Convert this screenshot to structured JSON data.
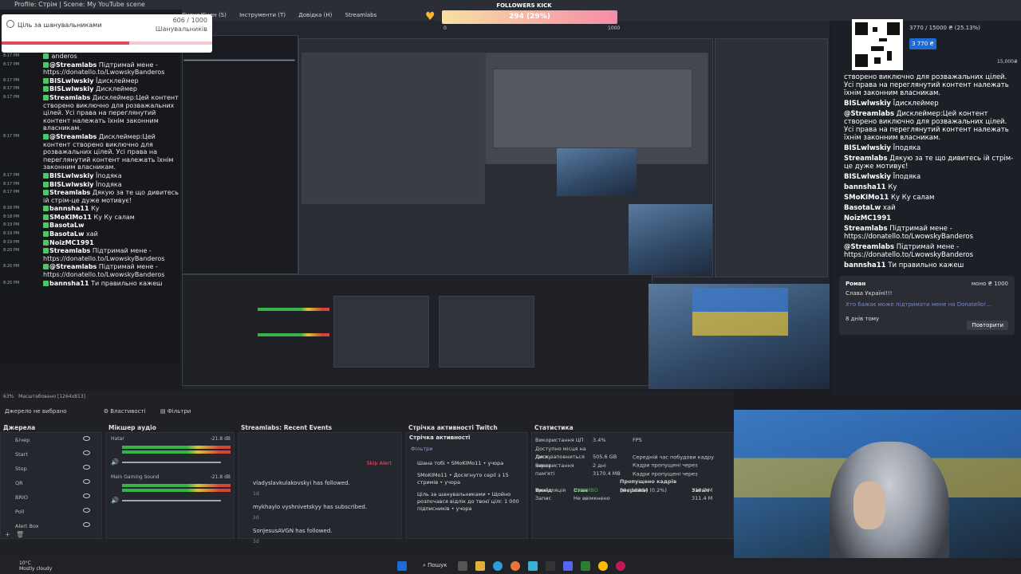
{
  "window": {
    "title": "Profile: Стрім | Scene: My YouTube scene",
    "menu": [
      "Сцена/Сцен (S)",
      "Інструменти (T)",
      "Довідка (H)",
      "Streamlabs"
    ]
  },
  "goal": {
    "label": "Ціль за шанувальниками",
    "count": "606 / 1000",
    "sublabel": "Шанувальників",
    "progress": 0.606
  },
  "kick": {
    "title": "FOLLOWERS KICK",
    "value": "294 (29%)",
    "min": "0",
    "max": "1000",
    "progress": 0.29
  },
  "left_chat": [
    {
      "time": "8:17 PM",
      "name": "",
      "text": "anderos"
    },
    {
      "time": "8:17 PM",
      "name": "@Streamlabs",
      "text": "Підтримай мене - https://donatello.to/LwowskyBanderos"
    },
    {
      "time": "8:17 PM",
      "name": "BISLwlwskiy",
      "text": "Їдисклеймер"
    },
    {
      "time": "8:17 PM",
      "name": "BISLwlwskiy",
      "text": "Дисклеймер"
    },
    {
      "time": "8:17 PM",
      "name": "Streamlabs",
      "text": "Дисклеймер:Цей контент створено виключно для розважальних цілей. Усі права на переглянутий контент належать їхнім законним власникам."
    },
    {
      "time": "8:17 PM",
      "name": "@Streamlabs",
      "text": "Дисклеймер:Цей контент створено виключно для розважальних цілей. Усі права на переглянутий контент належать їхнім законним власникам."
    },
    {
      "time": "8:17 PM",
      "name": "BISLwlwskiy",
      "text": "Їподяка"
    },
    {
      "time": "8:17 PM",
      "name": "BISLwlwskiy",
      "text": "Їподяка"
    },
    {
      "time": "8:17 PM",
      "name": "Streamlabs",
      "text": "Дякую за те що дивитесь ій стрім-це дуже мотивує!"
    },
    {
      "time": "8:18 PM",
      "name": "bannsha11",
      "text": "Ку"
    },
    {
      "time": "8:18 PM",
      "name": "SMoKIMo11",
      "text": "Ку Ку салам"
    },
    {
      "time": "8:19 PM",
      "name": "BasotaLw",
      "text": ""
    },
    {
      "time": "8:19 PM",
      "name": "BasotaLw",
      "text": "хай"
    },
    {
      "time": "8:19 PM",
      "name": "NoizMC1991",
      "text": ""
    },
    {
      "time": "8:20 PM",
      "name": "Streamlabs",
      "text": "Підтримай мене - https://donatello.to/LwowskyBanderos"
    },
    {
      "time": "8:20 PM",
      "name": "@Streamlabs",
      "text": "Підтримай мене - https://donatello.to/LwowskyBanderos"
    },
    {
      "time": "8:20 PM",
      "name": "bannsha11",
      "text": "Ти правильно кажеш"
    }
  ],
  "right_progress": {
    "text": "3770 / 15000 ₴ (25.13%)",
    "button": "3 770 ₴",
    "max": "15,000₴"
  },
  "right_chat": [
    {
      "name": "",
      "text": "створено виключно для розважальних цілей. Усі права на переглянутий контент належать їхнім законним власникам."
    },
    {
      "name": "BISLwlwskiy",
      "text": "Їдисклеймер"
    },
    {
      "name": "@Streamlabs",
      "text": "Дисклеймер:Цей контент створено виключно для розважальних цілей. Усі права на переглянутий контент належать їхнім законним власникам."
    },
    {
      "name": "BISLwlwskiy",
      "text": "Їподяка"
    },
    {
      "name": "Streamlabs",
      "text": "Дякую за те що дивитесь ій стрім-це дуже мотивує!"
    },
    {
      "name": "BISLwlwskiy",
      "text": "Їподяка"
    },
    {
      "name": "bannsha11",
      "text": "Ку"
    },
    {
      "name": "SMoKIMo11",
      "text": "Ку Ку салам"
    },
    {
      "name": "BasotaLw",
      "text": "хай"
    },
    {
      "name": "NoizMC1991",
      "text": ""
    },
    {
      "name": "Streamlabs",
      "text": "Підтримай мене - https://donatello.to/LwowskyBanderos"
    },
    {
      "name": "@Streamlabs",
      "text": "Підтримай мене - https://donatello.to/LwowskyBanderos"
    },
    {
      "name": "bannsha11",
      "text": "Ти правильно кажеш"
    }
  ],
  "donation": {
    "name": "Роман",
    "amount": "моно ₴ 1000",
    "text": "Слава Україні!!!",
    "hint": "Хто бажає може підтримати мене на Donatello!...",
    "date": "8 днів тому",
    "repeat": "Повторити"
  },
  "obs": {
    "zoom": "63%",
    "scale": "Масштабовано [1264x813]",
    "no_source": "Джерело не вибрано",
    "properties": "Властивості",
    "filters": "Фільтри",
    "sources_title": "Джерела",
    "sources": [
      "Бічер",
      "Start",
      "Stop",
      "QR",
      "BRIO",
      "Poll",
      "Alert Box"
    ],
    "mixer_title": "Мікшер аудіо",
    "mixer": [
      {
        "name": "Нatar",
        "db": "-21.8 dB",
        "level": 0.82
      },
      {
        "name": "Main Gaming Sound",
        "db": "-21.8 dB",
        "level": 0.82
      }
    ],
    "events_title": "Streamlabs: Recent Events",
    "skip_alert": "Skip Alert",
    "events": [
      {
        "text": "vladyslavkulakovskyi has followed.",
        "ago": "1d"
      },
      {
        "text": "mykhaylo vyshnivetskyy has subscribed.",
        "ago": "2d"
      },
      {
        "text": "SonJesusAVGN has followed.",
        "ago": "3d"
      }
    ],
    "twitch_title": "Стрічка активності Twitch",
    "twitch_sub": "Стрічка активності",
    "twitch_filter": "Фільтри",
    "twitch_items": [
      "Шана тобі • SMoKIMo11 • учора",
      "SMoKIMo11 • Досягнуто серії з 15 стримів • учора",
      "Ціль за шанувальниками • Щойно розпочався відлік до твоєї цілі: 1 000 підписників • учора"
    ],
    "stats_title": "Статистика",
    "stats": [
      [
        "Використання ЦП",
        "3.4%",
        "FPS",
        ""
      ],
      [
        "Доступно місця на диску",
        "505.6 GB",
        "Середній час побудови кадру",
        ""
      ],
      [
        "Диск заповниться через",
        "2 дні",
        "Кадри пропущені через",
        ""
      ],
      [
        "Використання пам'яті",
        "3170.4 MB",
        "Кадри пропущені через",
        ""
      ]
    ],
    "stats_table_head": [
      "Вихід",
      "Стан",
      "Пропущено кадрів (мережа)",
      "Загал"
    ],
    "stats_table": [
      [
        "Трансляція",
        "НАЖИВО",
        "30 / 19364 (0.2%)",
        "310.7 M"
      ],
      [
        "Запис",
        "Не ввімкнено",
        "",
        "311.4 M"
      ]
    ]
  },
  "taskbar": {
    "weather_temp": "10°C",
    "weather_text": "Mostly cloudy",
    "search": "Пошук"
  }
}
